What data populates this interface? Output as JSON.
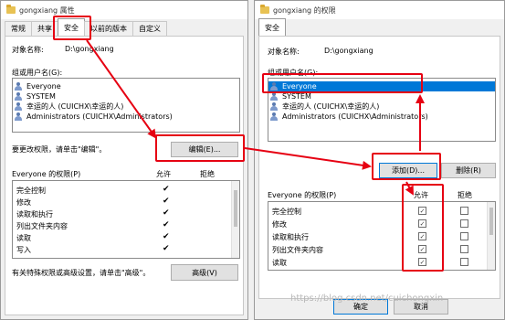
{
  "left_window": {
    "title": "gongxiang 属性",
    "tabs": [
      "常规",
      "共享",
      "安全",
      "以前的版本",
      "自定义"
    ],
    "active_tab": "安全",
    "object_label": "对象名称:",
    "object_value": "D:\\gongxiang",
    "group_label": "组或用户名(G):",
    "users": [
      "Everyone",
      "SYSTEM",
      "幸运的人 (CUICHX\\幸运的人)",
      "Administrators (CUICHX\\Administrators)"
    ],
    "change_hint": "要更改权限，请单击\"编辑\"。",
    "edit_button": "编辑(E)...",
    "perm_header": "Everyone 的权限(P)",
    "allow_header": "允许",
    "deny_header": "拒绝",
    "permissions": [
      "完全控制",
      "修改",
      "读取和执行",
      "列出文件夹内容",
      "读取",
      "写入"
    ],
    "allowed": [
      true,
      true,
      true,
      true,
      true,
      true
    ],
    "advanced_hint": "有关特殊权限或高级设置，请单击\"高级\"。",
    "advanced_button": "高级(V)"
  },
  "right_window": {
    "title": "gongxiang 的权限",
    "tab": "安全",
    "object_label": "对象名称:",
    "object_value": "D:\\gongxiang",
    "group_label": "组或用户名(G):",
    "users": [
      "Everyone",
      "SYSTEM",
      "幸运的人 (CUICHX\\幸运的人)",
      "Administrators (CUICHX\\Administrators)"
    ],
    "add_button": "添加(D)...",
    "remove_button": "删除(R)",
    "perm_header": "Everyone 的权限(P)",
    "allow_header": "允许",
    "deny_header": "拒绝",
    "permissions": [
      "完全控制",
      "修改",
      "读取和执行",
      "列出文件夹内容",
      "读取"
    ],
    "allow_checked": [
      true,
      true,
      true,
      true,
      true
    ],
    "deny_checked": [
      false,
      false,
      false,
      false,
      false
    ],
    "ok_button": "确定",
    "cancel_button": "取消"
  },
  "watermark": "https://blog.csdn.net/cuichongxin",
  "colors": {
    "annotation": "#e60012",
    "selection": "#0078d7"
  },
  "icons": {
    "folder": "folder-icon",
    "user": "user-group-icon",
    "check": "checkmark-icon"
  }
}
